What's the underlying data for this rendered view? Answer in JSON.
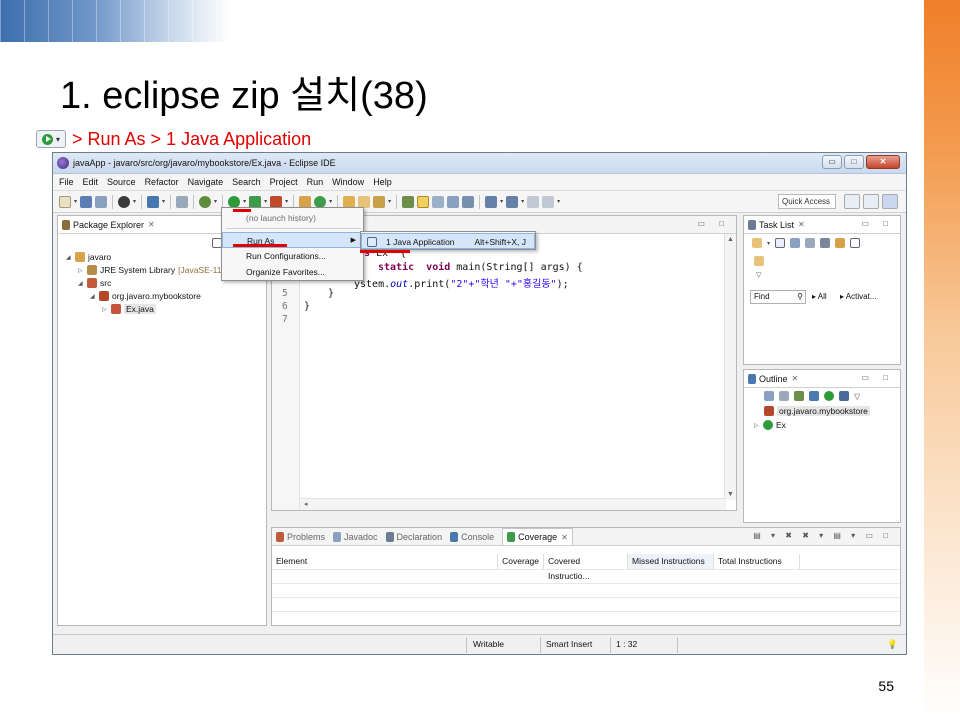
{
  "slide": {
    "title": "1. eclipse zip 설치(38)",
    "subtitle": "> Run As > 1 Java Application",
    "page_number": "55",
    "accent_color": "#e00000"
  },
  "window": {
    "title": "javaApp - javaro/src/org/javaro/mybookstore/Ex.java - Eclipse IDE",
    "controls": [
      "▭",
      "□",
      "✕"
    ]
  },
  "menubar": [
    "File",
    "Edit",
    "Source",
    "Refactor",
    "Navigate",
    "Search",
    "Project",
    "Run",
    "Window",
    "Help"
  ],
  "toolbar": {
    "quick_access": "Quick Access"
  },
  "package_explorer": {
    "tab": "Package Explorer",
    "tree": [
      {
        "label": "javaro",
        "icon": "project-icon"
      },
      {
        "label": "JRE System Library",
        "extra": "[JavaSE-11]",
        "icon": "library-icon"
      },
      {
        "label": "src",
        "icon": "source-folder-icon"
      },
      {
        "label": "org.javaro.mybookstore",
        "icon": "package-icon"
      },
      {
        "label": "Ex.java",
        "icon": "java-file-icon"
      }
    ]
  },
  "editor": {
    "line_numbers": [
      "5",
      "6",
      "7"
    ],
    "lines": [
      {
        "kw": "ass",
        "rest": " Ex  {"
      },
      {
        "kw": "static",
        "kw2": "void",
        "rest": " main(String[] args) {"
      },
      {
        "pre": "ystem.",
        "italic": "out",
        "mid": ".print(",
        "str": "\"2\"+\"학년 \"+\"홍길동\"",
        "end": ");"
      },
      {
        "rest": "}"
      },
      {
        "rest": "}"
      }
    ]
  },
  "run_menu": {
    "items": [
      "(no launch history)",
      "Run As",
      "Run Configurations...",
      "Organize Favorites..."
    ],
    "submenu": {
      "label": "1 Java Application",
      "shortcut": "Alt+Shift+X, J"
    }
  },
  "task_list": {
    "tab": "Task List",
    "find_placeholder": "Find",
    "all": "All",
    "activate": "Activat..."
  },
  "outline": {
    "tab": "Outline",
    "items": [
      "org.javaro.mybookstore",
      "Ex"
    ]
  },
  "bottom_panel": {
    "tabs": [
      "Problems",
      "Javadoc",
      "Declaration",
      "Console",
      "Coverage"
    ],
    "columns": [
      "Element",
      "Coverage",
      "Covered Instructio...",
      "Missed Instructions",
      "Total Instructions"
    ]
  },
  "statusbar": {
    "writable": "Writable",
    "insert_mode": "Smart Insert",
    "position": "1 : 32"
  }
}
